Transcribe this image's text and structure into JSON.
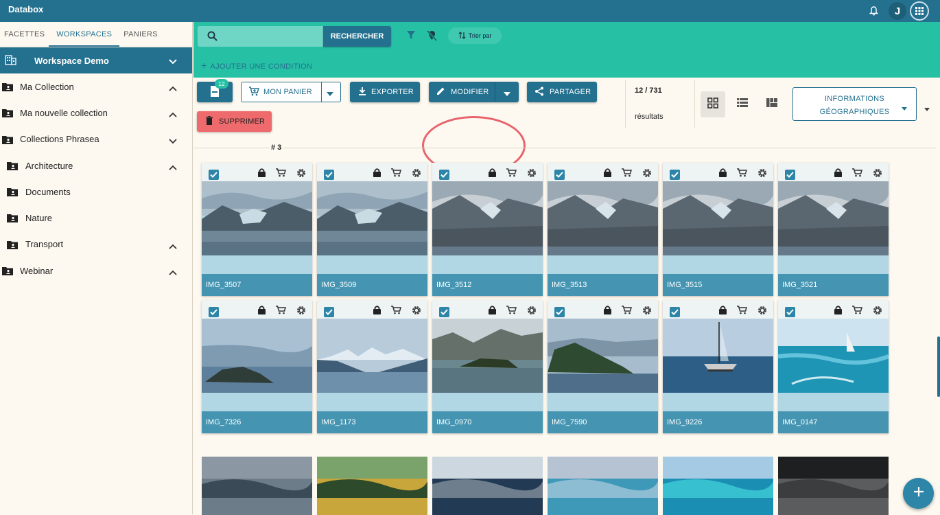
{
  "app": {
    "title": "Databox",
    "user_initial": "J"
  },
  "sidebar": {
    "tabs": [
      "FACETTES",
      "WORKSPACES",
      "PANIERS"
    ],
    "workspace": "Workspace Demo",
    "collections": [
      {
        "label": "Ma Collection",
        "chevron": "up"
      },
      {
        "label": "Ma nouvelle collection",
        "chevron": "up"
      },
      {
        "label": "Collections Phrasea",
        "chevron": "down"
      },
      {
        "label": "Architecture",
        "chevron": "up"
      },
      {
        "label": "Documents",
        "chevron": ""
      },
      {
        "label": "Nature",
        "chevron": ""
      },
      {
        "label": "Transport",
        "chevron": "up"
      },
      {
        "label": "Webinar",
        "chevron": "up"
      }
    ]
  },
  "search": {
    "placeholder": "",
    "button": "RECHERCHER",
    "sort_label": "Trier par",
    "add_condition": "AJOUTER UNE CONDITION"
  },
  "toolbar": {
    "basket_count": "12",
    "my_basket": "MON PANIER",
    "export": "EXPORTER",
    "modify": "MODIFIER",
    "share": "PARTAGER",
    "delete": "SUPPRIMER",
    "results_count": "12 / 731",
    "results_label": "résultats",
    "geo_line1": "INFORMATIONS",
    "geo_line2": "GÉOGRAPHIQUES"
  },
  "group": {
    "label": "# 3"
  },
  "cards": [
    {
      "title": "IMG_3507",
      "scene": "glacier"
    },
    {
      "title": "IMG_3509",
      "scene": "glacier"
    },
    {
      "title": "IMG_3512",
      "scene": "mountain"
    },
    {
      "title": "IMG_3513",
      "scene": "mountain"
    },
    {
      "title": "IMG_3515",
      "scene": "mountain"
    },
    {
      "title": "IMG_3521",
      "scene": "mountain"
    },
    {
      "title": "IMG_7326",
      "scene": "island"
    },
    {
      "title": "IMG_1173",
      "scene": "fjord"
    },
    {
      "title": "IMG_0970",
      "scene": "lake"
    },
    {
      "title": "IMG_7590",
      "scene": "forest-island"
    },
    {
      "title": "IMG_9226",
      "scene": "sailboat"
    },
    {
      "title": "IMG_0147",
      "scene": "sea"
    }
  ],
  "colors": {
    "primary": "#23708f",
    "accent": "#26c1a4",
    "danger": "#ee6a6d",
    "card_title": "#4595b2"
  }
}
